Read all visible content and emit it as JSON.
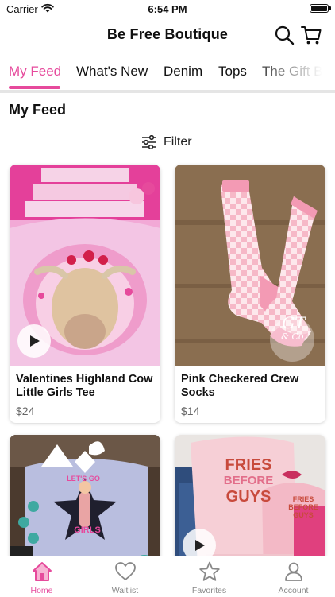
{
  "status_bar": {
    "carrier": "Carrier",
    "time": "6:54 PM"
  },
  "header": {
    "title": "Be Free Boutique"
  },
  "tabs": [
    {
      "label": "My Feed",
      "active": true
    },
    {
      "label": "What's New",
      "active": false
    },
    {
      "label": "Denim",
      "active": false
    },
    {
      "label": "Tops",
      "active": false
    },
    {
      "label": "The Gift Bo",
      "active": false
    }
  ],
  "feed": {
    "title": "My Feed",
    "filter_label": "Filter"
  },
  "products": [
    {
      "title": "Valentines Highland Cow Little Girls Tee",
      "price": "$24",
      "has_video": true
    },
    {
      "title": "Pink Checkered Crew Socks",
      "price": "$14",
      "has_video": false
    },
    {
      "title": "",
      "price": "",
      "has_video": false
    },
    {
      "title": "",
      "price": "",
      "has_video": true
    }
  ],
  "image_text": {
    "socks_logo": "GT",
    "socks_logo_sub": "& Co.",
    "lets_go_girls": "LET'S GO",
    "girls": "GIRLS",
    "fries_line1": "FRIES",
    "fries_line2": "BEFORE",
    "fries_line3": "GUYS"
  },
  "bottom_nav": [
    {
      "label": "Home",
      "icon": "home-icon",
      "active": true
    },
    {
      "label": "Waitlist",
      "icon": "heart-icon",
      "active": false
    },
    {
      "label": "Favorites",
      "icon": "star-icon",
      "active": false
    },
    {
      "label": "Account",
      "icon": "person-icon",
      "active": false
    }
  ],
  "colors": {
    "accent": "#e64a9c",
    "muted": "#888888"
  }
}
